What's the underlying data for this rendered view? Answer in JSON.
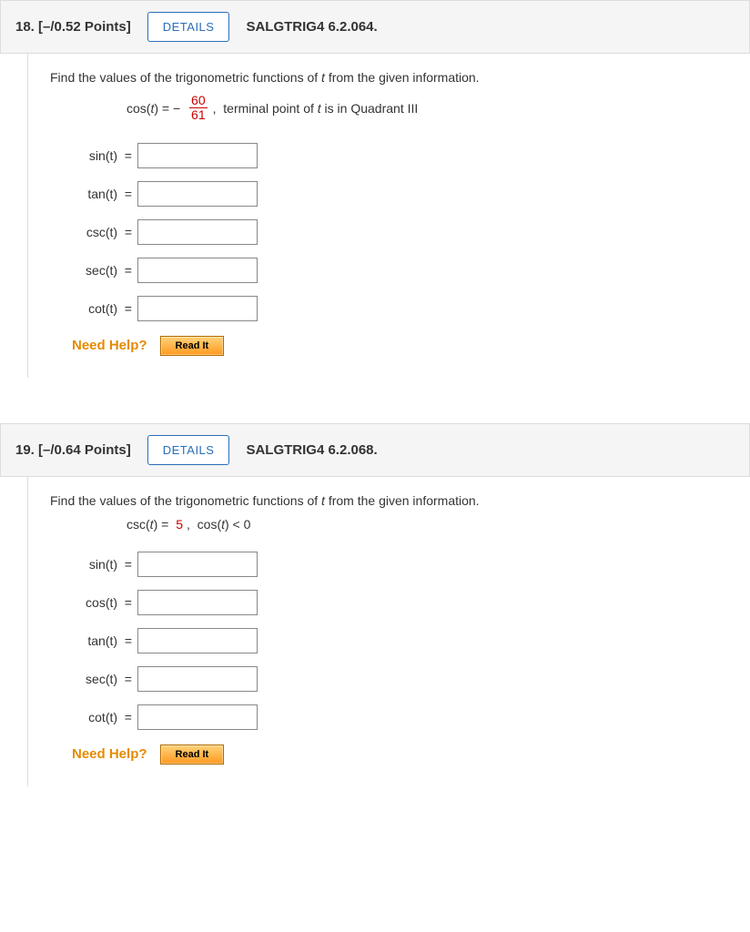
{
  "q18": {
    "number": "18.",
    "points": "[–/0.52 Points]",
    "details": "DETAILS",
    "source": "SALGTRIG4 6.2.064.",
    "prompt": "Find the values of the trigonometric functions of t from the given information.",
    "given_prefix": "cos(t) = − ",
    "frac_num": "60",
    "frac_den": "61",
    "given_suffix": ",  terminal point of t is in Quadrant III",
    "rows": [
      "sin(t)  =",
      "tan(t)  =",
      "csc(t)  =",
      "sec(t)  =",
      "cot(t)  ="
    ],
    "need_help": "Need Help?",
    "read_it": "Read It"
  },
  "q19": {
    "number": "19.",
    "points": "[–/0.64 Points]",
    "details": "DETAILS",
    "source": "SALGTRIG4 6.2.068.",
    "prompt": "Find the values of the trigonometric functions of t from the given information.",
    "given_prefix": "csc(t) = ",
    "given_value": "5",
    "given_suffix": ",  cos(t) < 0",
    "rows": [
      "sin(t)  =",
      "cos(t)  =",
      "tan(t)  =",
      "sec(t)  =",
      "cot(t)  ="
    ],
    "need_help": "Need Help?",
    "read_it": "Read It"
  }
}
